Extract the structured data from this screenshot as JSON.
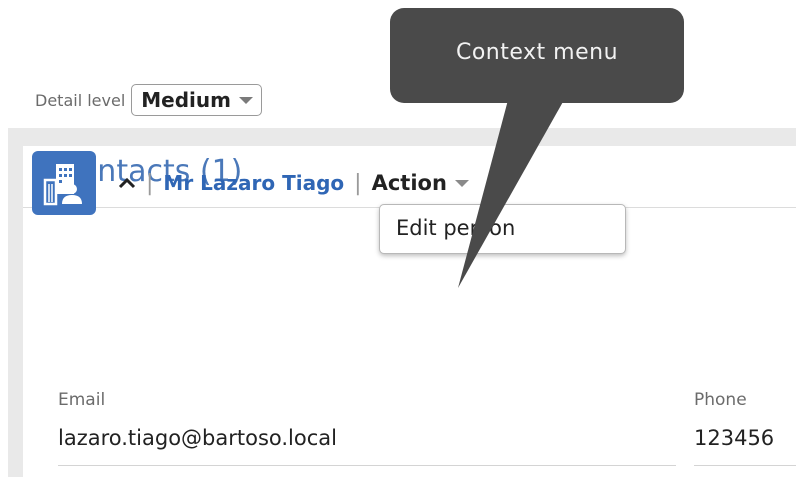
{
  "tooltip": {
    "text": "Context menu",
    "background": "#4a4a4a"
  },
  "panel": {
    "title": "Contacts (1)"
  },
  "detail_level": {
    "label": "Detail level",
    "selected": "Medium"
  },
  "contact": {
    "icon": "company-contact-icon",
    "toggle_icon": "chevron-up-icon",
    "name": "Mr Lazaro Tiago",
    "action_label": "Action"
  },
  "action_menu": {
    "items": [
      {
        "label": "Edit person"
      }
    ]
  },
  "fields": {
    "email": {
      "label": "Email",
      "value": "lazaro.tiago@bartoso.local"
    },
    "phone": {
      "label": "Phone",
      "value": "123456"
    }
  },
  "colors": {
    "accent": "#4a78b9",
    "link": "#2f66b5",
    "icon_bg": "#3f73be"
  }
}
